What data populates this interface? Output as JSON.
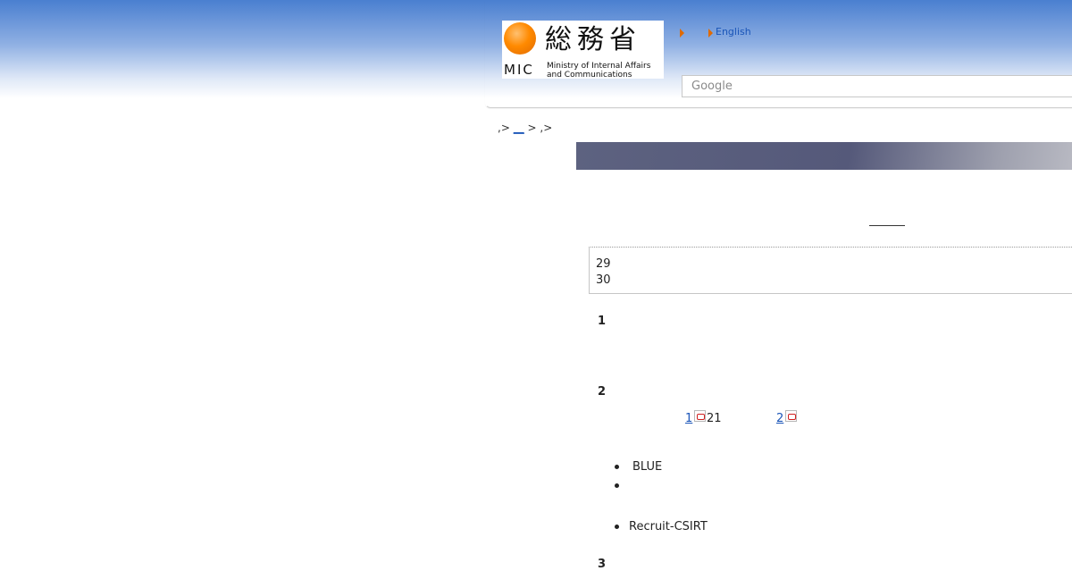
{
  "header": {
    "logo": {
      "kanji": "総務省",
      "abbrev": "MIC",
      "ministry_line1": "Ministry of Internal Affairs",
      "ministry_line2": "and Communications"
    },
    "english_link": "English",
    "search_placeholder": "Google"
  },
  "breadcrumb": {
    "sep1": ",>",
    "link": "__",
    "sep2": ">",
    "sep3": ",>"
  },
  "info_box": {
    "line1": "29",
    "line2": "30"
  },
  "sections": [
    {
      "num": "1"
    },
    {
      "num": "2"
    },
    {
      "num": "3"
    }
  ],
  "attachments": {
    "link1": "1",
    "after1": "21",
    "link2": "2"
  },
  "list_a": [
    "BLUE",
    ""
  ],
  "list_b": [
    "Recruit-CSIRT"
  ],
  "colors": {
    "accent_orange": "#e06a00",
    "link_blue": "#1a55b8",
    "title_bar": "#55597a"
  }
}
